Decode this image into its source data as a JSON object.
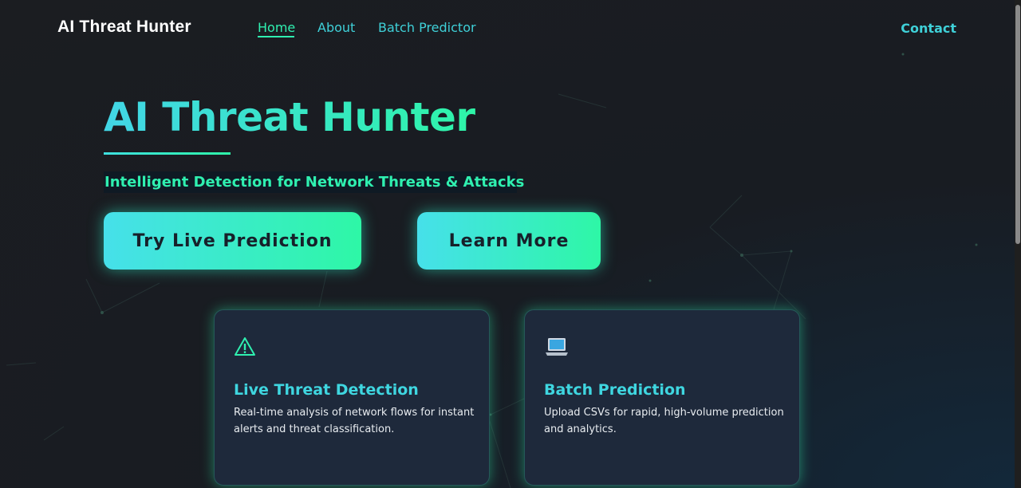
{
  "nav": {
    "brand": "AI Threat Hunter",
    "links": [
      {
        "label": "Home",
        "active": true
      },
      {
        "label": "About",
        "active": false
      },
      {
        "label": "Batch Predictor",
        "active": false
      }
    ],
    "contact": "Contact"
  },
  "hero": {
    "title": "AI Threat Hunter",
    "subtitle": "Intelligent Detection for Network Threats & Attacks",
    "primary_button": "Try Live Prediction",
    "secondary_button": "Learn More"
  },
  "cards": [
    {
      "icon": "warning-icon",
      "title": "Live Threat Detection",
      "text": "Real-time analysis of network flows for instant alerts and threat classification."
    },
    {
      "icon": "laptop-icon",
      "title": "Batch Prediction",
      "text": "Upload CSVs for rapid, high-volume prediction and analytics."
    }
  ],
  "colors": {
    "accent_cyan": "#3fd6e0",
    "accent_green": "#2ef5a8",
    "background": "#1b1d21",
    "card": "#1e293b"
  }
}
